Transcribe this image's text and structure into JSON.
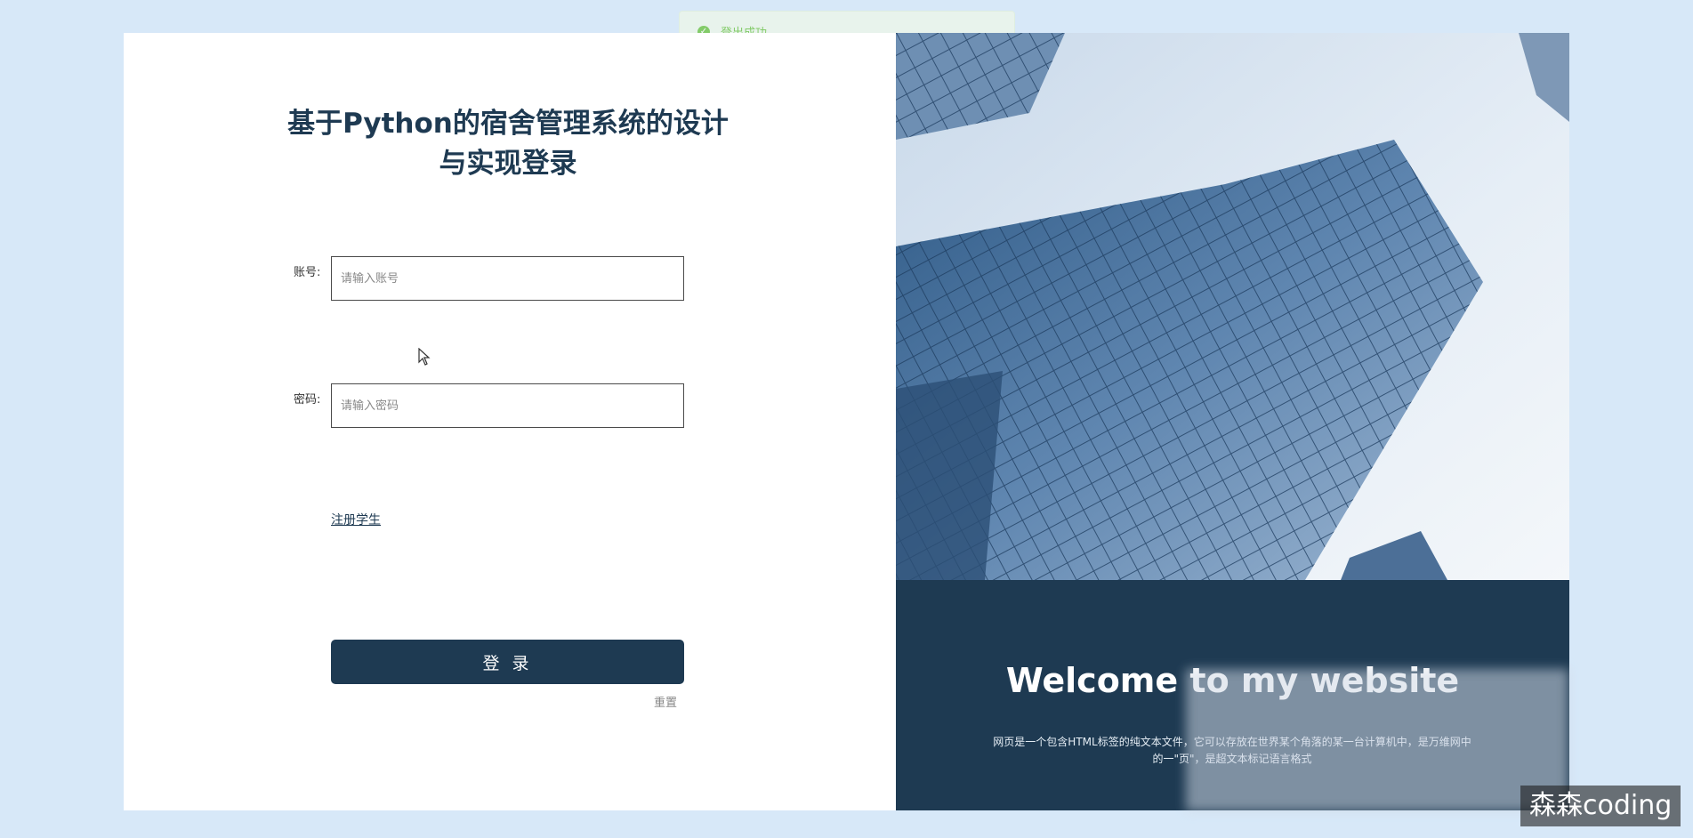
{
  "toast": {
    "text": "登出成功",
    "icon": "check-circle-icon",
    "color": "#67c23a"
  },
  "login": {
    "title": "基于Python的宿舍管理系统的设计与实现登录",
    "account_label": "账号:",
    "account_placeholder": "请输入账号",
    "password_label": "密码:",
    "password_placeholder": "请输入密码",
    "register_link": "注册学生",
    "login_button": "登 录",
    "reset_link": "重置"
  },
  "panel": {
    "welcome_title": "Welcome to my website",
    "welcome_text": "网页是一个包含HTML标签的纯文本文件，它可以存放在世界某个角落的某一台计算机中，是万维网中的一\"页\"，是超文本标记语言格式",
    "accent_color": "#1e3a52"
  },
  "watermark": {
    "text": "森森coding"
  }
}
